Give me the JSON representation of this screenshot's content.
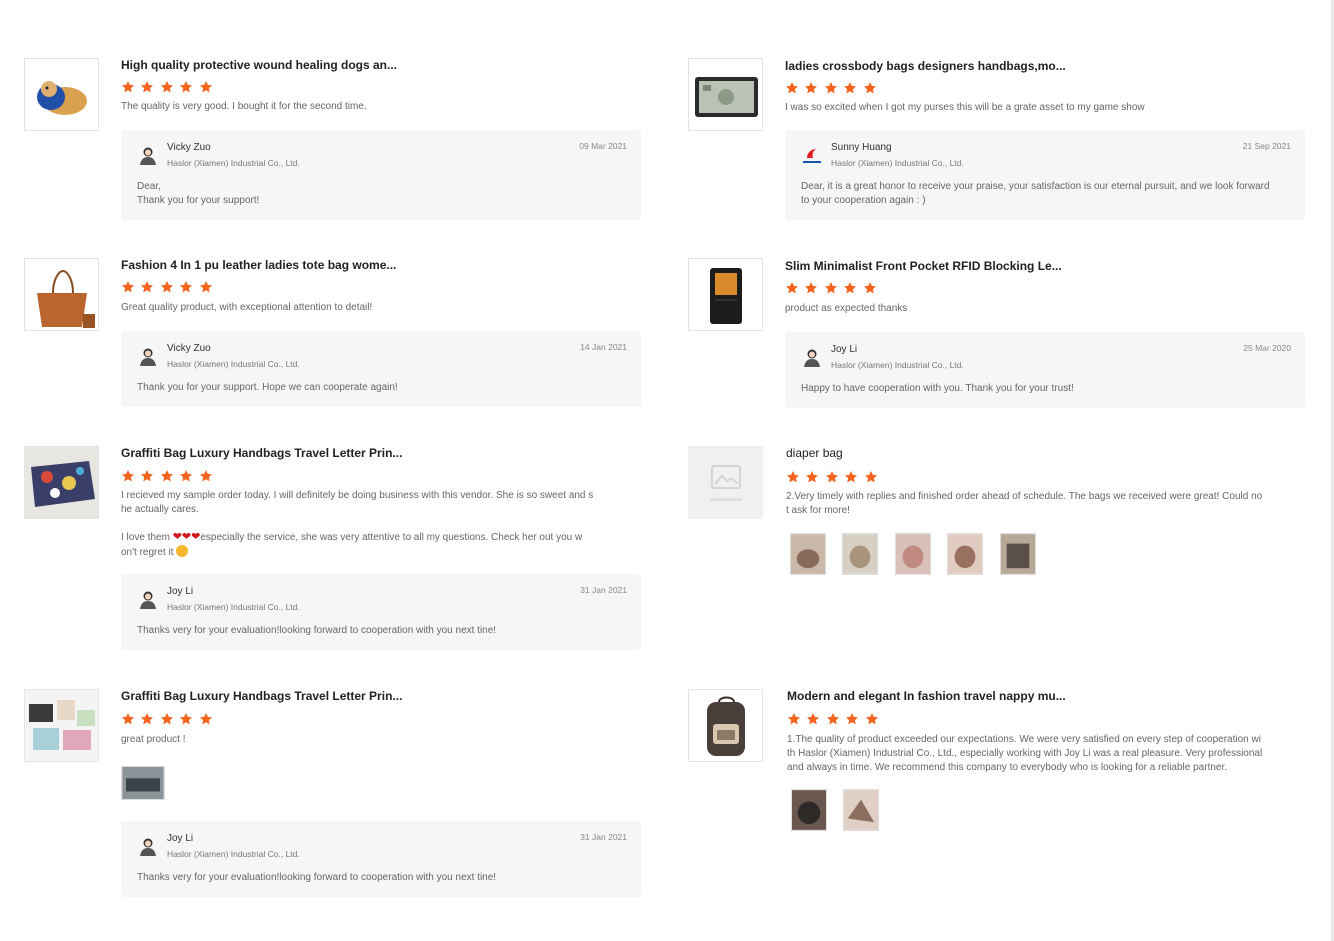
{
  "colors": {
    "star": "#f5641e",
    "reply_bg": "#f5f6f8",
    "heart": "#d0191c"
  },
  "rating_max": 5,
  "reviews": [
    {
      "title": "High quality protective wound healing dogs an...",
      "rating": 5,
      "text": "The quality is very good. I bought it for the second time.",
      "thumb_icon": "dog-cone-product-icon",
      "reply": {
        "name": "Vicky Zuo",
        "company": "Haslor (Xiamen) Industrial Co., Ltd.",
        "date": "09 Mar 2021",
        "message_line1": "Dear,",
        "message_line2": "Thank you for your support!"
      }
    },
    {
      "title": "ladies crossbody bags designers handbags,mo...",
      "rating": 5,
      "text": "I was so excited when I got my purses this will be a grate asset to my game show",
      "thumb_icon": "money-purse-product-icon",
      "reply": {
        "name": "Sunny Huang",
        "company": "Haslor (Xiamen) Industrial Co., Ltd.",
        "date": "21 Sep 2021",
        "message_line1": "Dear, it is a great honor to receive your praise, your satisfaction is our eternal pursuit, and we look forward",
        "message_line2": "to your cooperation again : )"
      }
    },
    {
      "title": "Fashion 4 In 1 pu leather ladies tote bag wome...",
      "rating": 5,
      "text": "Great quality product, with exceptional attention to detail!",
      "thumb_icon": "tote-bag-product-icon",
      "reply": {
        "name": "Vicky Zuo",
        "company": "Haslor (Xiamen) Industrial Co., Ltd.",
        "date": "14 Jan 2021",
        "message_line1": "Thank you for your support. Hope we can cooperate again!"
      }
    },
    {
      "title": "Slim Minimalist Front Pocket RFID Blocking Le...",
      "rating": 5,
      "text": "product as expected thanks",
      "thumb_icon": "wallet-product-icon",
      "reply": {
        "name": "Joy Li",
        "company": "Haslor (Xiamen) Industrial Co., Ltd.",
        "date": "25 Mar 2020",
        "message_line1": "Happy to have cooperation with you. Thank you for your trust!"
      }
    },
    {
      "title": "Graffiti Bag Luxury Handbags Travel Letter Prin...",
      "rating": 5,
      "text_line1": "I recieved my sample order today. I will definitely be doing business with this vendor. She is so sweet and s",
      "text_line2": "he actually cares.",
      "text_line3_start": "I love them ",
      "text_line3_end": "especially the service, she was very attentive to all my questions. Check her out you w",
      "text_line4": "on't regret it",
      "thumb_icon": "graffiti-bag-product-icon",
      "reply": {
        "name": "Joy Li",
        "company": "Haslor (Xiamen) Industrial Co., Ltd.",
        "date": "31 Jan 2021",
        "message_line1": "Thanks very for your evaluation!looking forward to cooperation with you next tine!"
      }
    },
    {
      "title": "diaper bag",
      "rating": 5,
      "text_line1": "2.Very timely with replies and finished order ahead of schedule. The bags we received were great! Could no",
      "text_line2": "t ask for more!",
      "thumb_icon": "no-photo-placeholder-icon",
      "photo_count": 5
    },
    {
      "title": "Graffiti Bag Luxury Handbags Travel Letter Prin...",
      "rating": 5,
      "text": "great product !",
      "thumb_icon": "graffiti-bags-set-product-icon",
      "photo_count": 1,
      "reply": {
        "name": "Joy Li",
        "company": "Haslor (Xiamen) Industrial Co., Ltd.",
        "date": "31 Jan 2021",
        "message_line1": "Thanks very for your evaluation!looking forward to cooperation with you next tine!"
      }
    },
    {
      "title": "Modern and elegant In fashion travel nappy mu...",
      "rating": 5,
      "text_line1": "1.The quality of product exceeded our expectations. We were very satisfied on every step of cooperation wi",
      "text_line2": "th Haslor (Xiamen) Industrial Co., Ltd., especially working with Joy Li was a real pleasure. Very professional",
      "text_line3": "and always in time. We recommend this company to everybody who is looking for a reliable partner.",
      "thumb_icon": "backpack-product-icon",
      "photo_count": 2
    }
  ]
}
